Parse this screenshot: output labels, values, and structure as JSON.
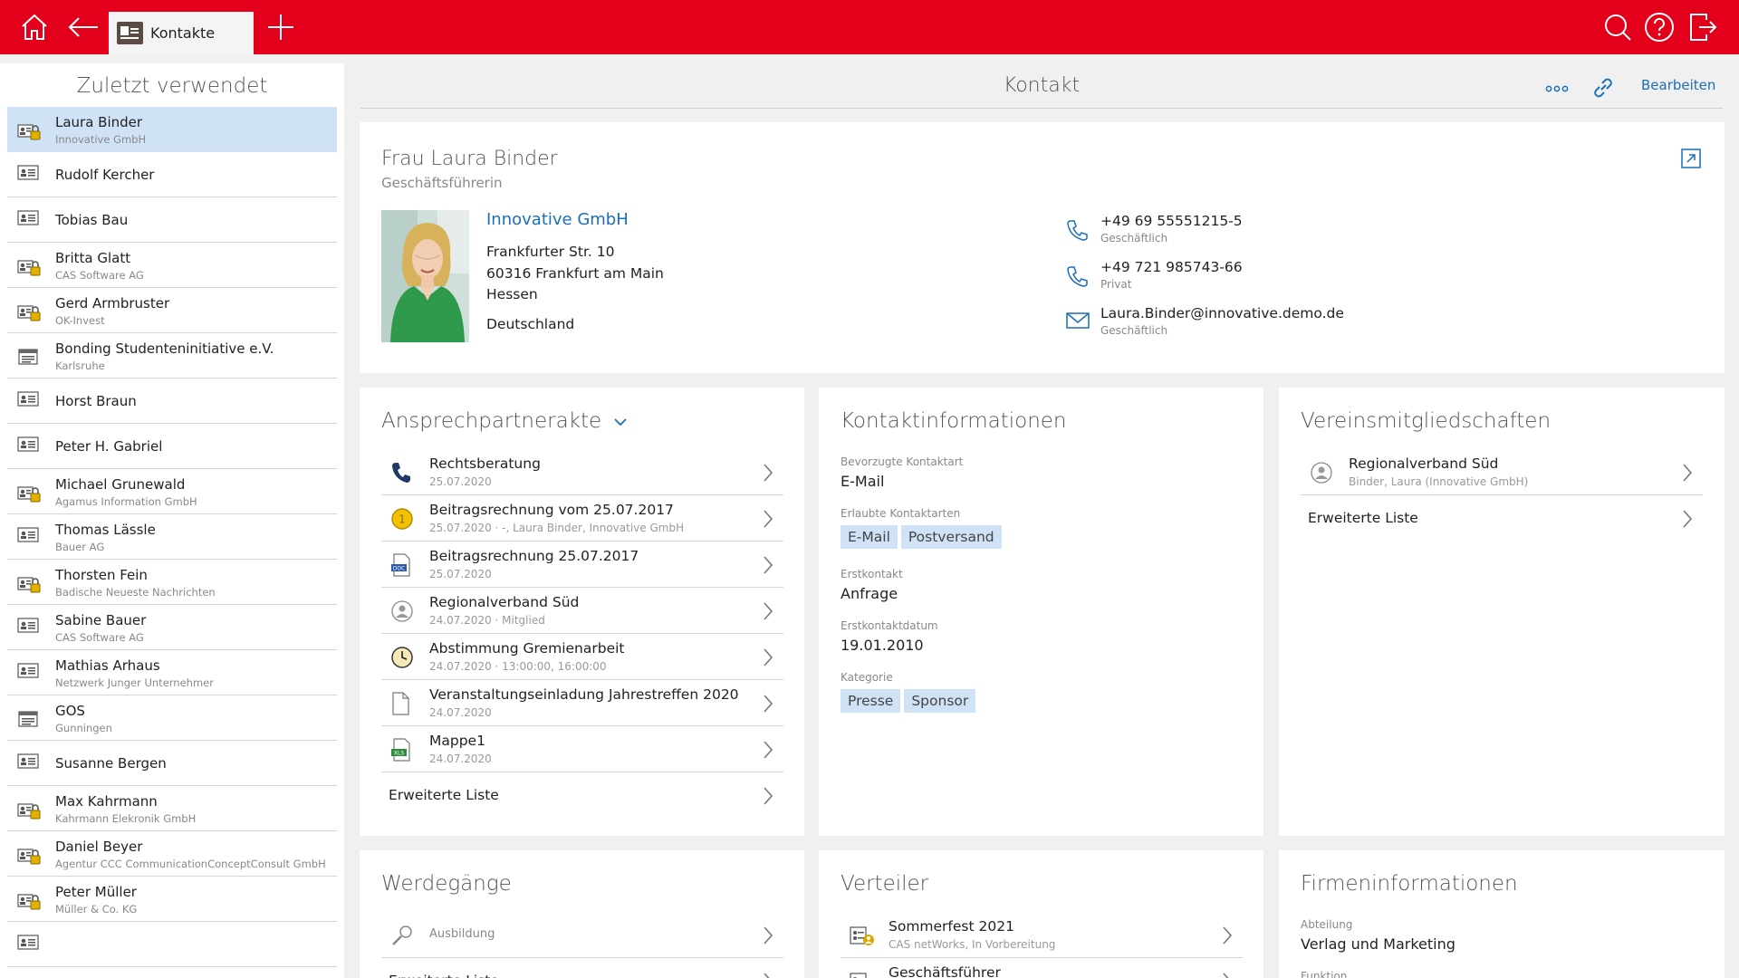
{
  "topbar": {
    "tab_label": "Kontakte",
    "home_icon": "home-icon",
    "back_icon": "back-arrow-icon",
    "add_icon": "plus-icon",
    "search_icon": "search-icon",
    "help_icon": "help-icon",
    "logout_icon": "logout-icon",
    "brand_color": "#e2001a"
  },
  "sidebar": {
    "title": "Zuletzt verwendet",
    "items": [
      {
        "name": "Laura Binder",
        "sub": "Innovative GmbH",
        "icon": "person-lock-icon",
        "selected": true
      },
      {
        "name": "Rudolf Kercher",
        "sub": "",
        "icon": "contact-card-icon"
      },
      {
        "name": "Tobias Bau",
        "sub": "",
        "icon": "contact-card-icon"
      },
      {
        "name": "Britta Glatt",
        "sub": "CAS Software AG",
        "icon": "person-lock-icon"
      },
      {
        "name": "Gerd Armbruster",
        "sub": "OK-Invest",
        "icon": "person-lock-icon"
      },
      {
        "name": "Bonding Studenteninitiative e.V.",
        "sub": "Karlsruhe",
        "icon": "company-icon"
      },
      {
        "name": "Horst Braun",
        "sub": "",
        "icon": "contact-card-icon"
      },
      {
        "name": "Peter H. Gabriel",
        "sub": "",
        "icon": "contact-card-icon"
      },
      {
        "name": "Michael Grunewald",
        "sub": "Agamus Information GmbH",
        "icon": "person-lock-icon"
      },
      {
        "name": "Thomas Lässle",
        "sub": "Bauer AG",
        "icon": "contact-card-icon"
      },
      {
        "name": "Thorsten Fein",
        "sub": "Badische Neueste Nachrichten",
        "icon": "person-lock-icon"
      },
      {
        "name": "Sabine Bauer",
        "sub": "CAS Software AG",
        "icon": "contact-card-icon"
      },
      {
        "name": "Mathias Arhaus",
        "sub": "Netzwerk Junger Unternehmer",
        "icon": "contact-card-icon"
      },
      {
        "name": "GOS",
        "sub": "Gunningen",
        "icon": "company-icon"
      },
      {
        "name": "Susanne Bergen",
        "sub": "",
        "icon": "contact-card-icon"
      },
      {
        "name": "Max Kahrmann",
        "sub": "Kahrmann Elekronik GmbH",
        "icon": "person-lock-icon"
      },
      {
        "name": "Daniel Beyer",
        "sub": "Agentur CCC CommunicationConceptConsult GmbH",
        "icon": "person-lock-icon"
      },
      {
        "name": "Peter Müller",
        "sub": "Müller & Co. KG",
        "icon": "person-lock-icon"
      },
      {
        "name": "",
        "sub": "",
        "icon": "contact-card-icon"
      }
    ]
  },
  "main": {
    "title": "Kontakt",
    "more_icon": "more-icon",
    "link_icon": "link-icon",
    "edit_label": "Bearbeiten"
  },
  "contact": {
    "name": "Frau Laura Binder",
    "role": "Geschäftsführerin",
    "company": "Innovative GmbH",
    "street": "Frankfurter Str. 10",
    "city": "60316 Frankfurt am Main",
    "state": "Hessen",
    "country": "Deutschland",
    "photo_icon": "person-photo",
    "open_icon": "open-external-icon",
    "details": [
      {
        "value": "+49 69 55551215-5",
        "label": "Geschäftlich",
        "icon": "phone-icon"
      },
      {
        "value": "+49 721 985743-66",
        "label": "Privat",
        "icon": "phone-icon"
      },
      {
        "value": "Laura.Binder@innovative.demo.de",
        "label": "Geschäftlich",
        "icon": "mail-icon"
      }
    ]
  },
  "akte": {
    "title": "Ansprechpartnerakte",
    "items": [
      {
        "title": "Rechtsberatung",
        "sub": "25.07.2020",
        "icon": "phone-call-icon"
      },
      {
        "title": "Beitragsrechnung vom 25.07.2017",
        "sub": "25.07.2020 · -, Laura Binder, Innovative GmbH",
        "icon": "coin-icon"
      },
      {
        "title": "Beitragsrechnung 25.07.2017",
        "sub": "25.07.2020",
        "icon": "doc-file-icon"
      },
      {
        "title": "Regionalverband Süd",
        "sub": "24.07.2020 · Mitglied",
        "icon": "member-icon"
      },
      {
        "title": "Abstimmung Gremienarbeit",
        "sub": "24.07.2020 · 13:00:00, 16:00:00",
        "icon": "clock-icon"
      },
      {
        "title": "Veranstaltungseinladung Jahrestreffen 2020",
        "sub": "24.07.2020",
        "icon": "blank-file-icon"
      },
      {
        "title": "Mappe1",
        "sub": "24.07.2020",
        "icon": "xls-file-icon"
      }
    ],
    "more_label": "Erweiterte Liste"
  },
  "kontaktinfo": {
    "title": "Kontaktinformationen",
    "preferred_label": "Bevorzugte Kontaktart",
    "preferred_value": "E-Mail",
    "allowed_label": "Erlaubte Kontaktarten",
    "allowed_tags": [
      "E-Mail",
      "Postversand"
    ],
    "first_label": "Erstkontakt",
    "first_value": "Anfrage",
    "first_date_label": "Erstkontaktdatum",
    "first_date_value": "19.01.2010",
    "category_label": "Kategorie",
    "category_tags": [
      "Presse",
      "Sponsor"
    ]
  },
  "verein": {
    "title": "Vereinsmitgliedschaften",
    "items": [
      {
        "title": "Regionalverband Süd",
        "sub": "Binder, Laura (Innovative GmbH)",
        "icon": "member-icon"
      }
    ],
    "more_label": "Erweiterte Liste"
  },
  "werdegaenge": {
    "title": "Werdegänge",
    "items": [
      {
        "title": "Ausbildung",
        "icon": "magnifier-icon"
      }
    ],
    "more_label": "Erweiterte Liste"
  },
  "verteiler": {
    "title": "Verteiler",
    "items": [
      {
        "title": "Sommerfest 2021",
        "sub": "CAS netWorks, In Vorbereitung",
        "icon": "distribution-list-icon"
      },
      {
        "title": "Geschäftsführer",
        "sub": "",
        "icon": "distribution-list-icon"
      }
    ]
  },
  "firma": {
    "title": "Firmeninformationen",
    "dept_label": "Abteilung",
    "dept_value": "Verlag und Marketing",
    "function_label": "Funktion"
  }
}
